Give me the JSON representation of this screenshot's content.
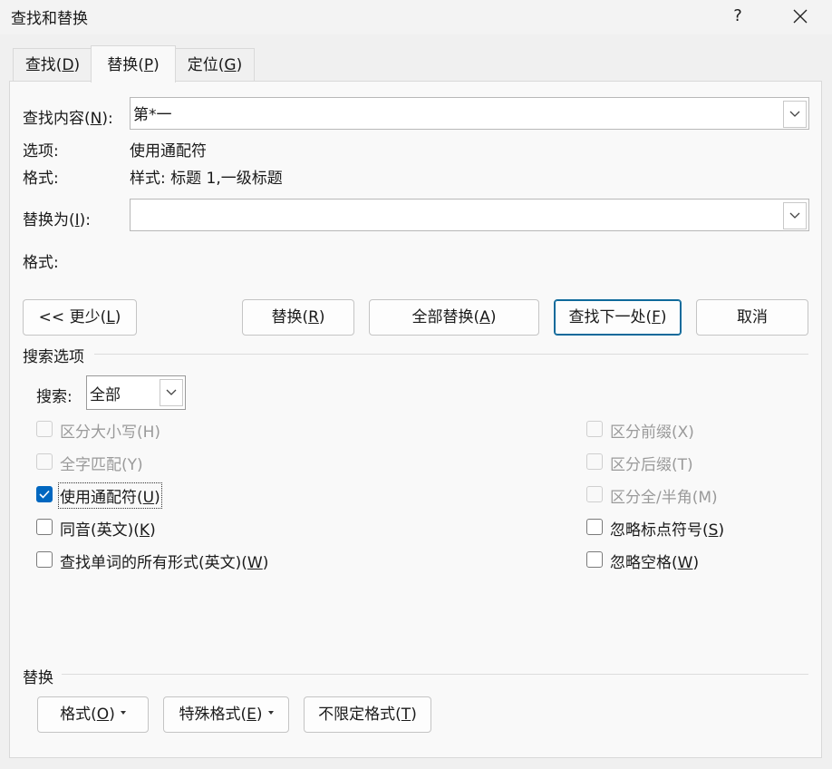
{
  "window": {
    "title": "查找和替换",
    "help": "?",
    "close_icon": "close-icon"
  },
  "tabs": [
    {
      "pre": "查找(",
      "key": "D",
      "post": ")"
    },
    {
      "pre": "替换(",
      "key": "P",
      "post": ")"
    },
    {
      "pre": "定位(",
      "key": "G",
      "post": ")"
    }
  ],
  "active_tab": 1,
  "find": {
    "label_pre": "查找内容(",
    "label_key": "N",
    "label_post": "):",
    "value": "第*一",
    "options_label": "选项:",
    "options_value": "使用通配符",
    "format_label": "格式:",
    "format_value": "样式: 标题 1,一级标题"
  },
  "replace": {
    "label_pre": "替换为(",
    "label_key": "I",
    "label_post": "):",
    "value": "",
    "format_label": "格式:"
  },
  "buttons": {
    "less": {
      "pre": "<< 更少(",
      "key": "L",
      "post": ")"
    },
    "replace": {
      "pre": "替换(",
      "key": "R",
      "post": ")"
    },
    "replace_all": {
      "pre": "全部替换(",
      "key": "A",
      "post": ")"
    },
    "find_next": {
      "pre": "查找下一处(",
      "key": "F",
      "post": ")"
    },
    "cancel": "取消"
  },
  "search_options": {
    "title": "搜索选项",
    "search_label": "搜索:",
    "search_value": "全部",
    "left": [
      {
        "pre": "区分大小写(H)",
        "key": "",
        "post": "",
        "checked": false,
        "disabled": true
      },
      {
        "pre": "全字匹配(Y)",
        "key": "",
        "post": "",
        "checked": false,
        "disabled": true
      },
      {
        "pre": "使用通配符(",
        "key": "U",
        "post": ")",
        "checked": true,
        "disabled": false
      },
      {
        "pre": "同音(英文)(",
        "key": "K",
        "post": ")",
        "checked": false,
        "disabled": false
      },
      {
        "pre": "查找单词的所有形式(英文)(",
        "key": "W",
        "post": ")",
        "checked": false,
        "disabled": false
      }
    ],
    "right": [
      {
        "pre": "区分前缀(X)",
        "key": "",
        "post": "",
        "checked": false,
        "disabled": true
      },
      {
        "pre": "区分后缀(T)",
        "key": "",
        "post": "",
        "checked": false,
        "disabled": true
      },
      {
        "pre": "区分全/半角(M)",
        "key": "",
        "post": "",
        "checked": false,
        "disabled": true
      },
      {
        "pre": "忽略标点符号(",
        "key": "S",
        "post": ")",
        "checked": false,
        "disabled": false
      },
      {
        "pre": "忽略空格(",
        "key": "W",
        "post": ")",
        "checked": false,
        "disabled": false
      }
    ]
  },
  "replace_section": {
    "title": "替换",
    "format_btn": {
      "pre": "格式(",
      "key": "O",
      "post": ")"
    },
    "special_btn": {
      "pre": "特殊格式(",
      "key": "E",
      "post": ")"
    },
    "no_format_btn": {
      "pre": "不限定格式(",
      "key": "T",
      "post": ")"
    }
  }
}
